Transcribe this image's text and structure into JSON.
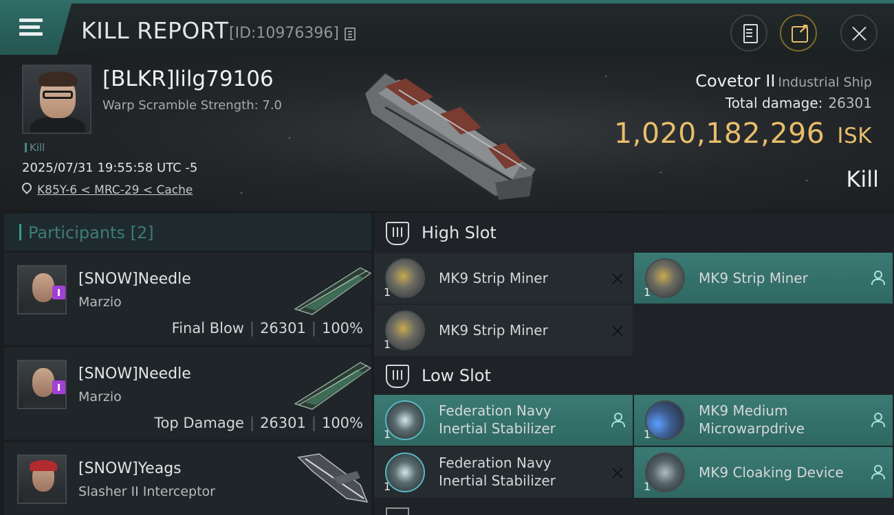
{
  "header": {
    "title": "KILL REPORT",
    "id_text": "[ID:10976396]"
  },
  "victim": {
    "name": "[BLKR]lilg79106",
    "warp_scramble": "Warp Scramble Strength: 7.0",
    "kill_tag": "Kill",
    "timestamp": "2025/07/31 19:55:58 UTC -5",
    "location": "K85Y-6 < MRC-29 < Cache"
  },
  "ship": {
    "name": "Covetor II",
    "class": "Industrial Ship",
    "total_damage_label": "Total damage:",
    "total_damage": "26301",
    "isk_value": "1,020,182,296",
    "isk_unit": "ISK",
    "result": "Kill"
  },
  "participants": {
    "title": "Participants",
    "count": "[2]",
    "rows": [
      {
        "name": "[SNOW]Needle",
        "ship": "Marzio",
        "role": "Final Blow",
        "damage": "26301",
        "percent": "100%"
      },
      {
        "name": "[SNOW]Needle",
        "ship": "Marzio",
        "role": "Top Damage",
        "damage": "26301",
        "percent": "100%"
      },
      {
        "name": "[SNOW]Yeags",
        "ship": "Slasher II Interceptor"
      }
    ]
  },
  "fitting": {
    "high_slot_title": "High Slot",
    "low_slot_title": "Low Slot",
    "high": [
      {
        "name": "MK9 Strip Miner",
        "qty": "1",
        "status": "destroyed"
      },
      {
        "name": "MK9 Strip Miner",
        "qty": "1",
        "status": "dropped"
      },
      {
        "name": "MK9 Strip Miner",
        "qty": "1",
        "status": "destroyed"
      }
    ],
    "low": [
      {
        "name_line1": "Federation Navy",
        "name_line2": "Inertial Stabilizer",
        "qty": "1",
        "status": "dropped"
      },
      {
        "name_line1": "MK9 Medium",
        "name_line2": "Microwarpdrive",
        "qty": "1",
        "status": "dropped"
      },
      {
        "name_line1": "Federation Navy",
        "name_line2": "Inertial Stabilizer",
        "qty": "1",
        "status": "destroyed"
      },
      {
        "name": "MK9 Cloaking Device",
        "qty": "1",
        "status": "dropped"
      }
    ]
  },
  "colors": {
    "accent_teal": "#2f6e69",
    "isk_gold": "#e8be6a",
    "implant_badge": "#a43fd6"
  }
}
